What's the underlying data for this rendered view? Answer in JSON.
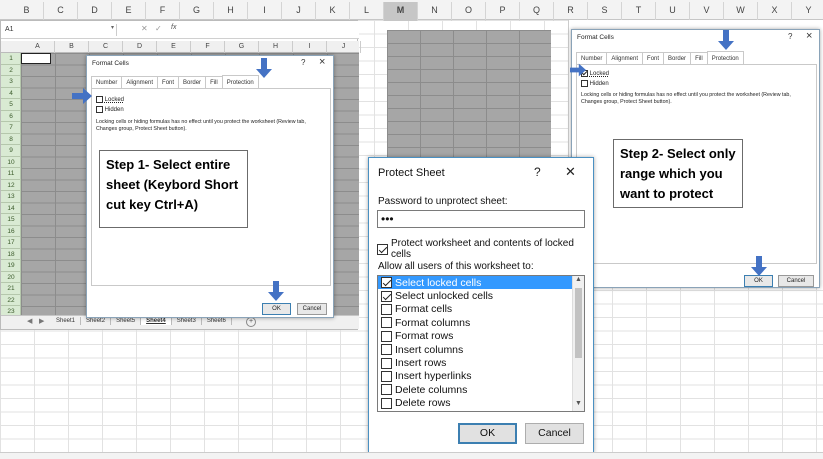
{
  "main_sheet": {
    "columns": [
      "B",
      "C",
      "D",
      "E",
      "F",
      "G",
      "H",
      "I",
      "J",
      "K",
      "L",
      "M",
      "N",
      "O",
      "P",
      "Q",
      "R",
      "S",
      "T",
      "U",
      "V",
      "W",
      "X",
      "Y"
    ],
    "selected_column": "M",
    "name_box": "A1",
    "fx_label": "fx"
  },
  "left_excel": {
    "columns": [
      "A",
      "B",
      "C",
      "D",
      "E",
      "F",
      "G",
      "H",
      "I",
      "J"
    ],
    "rows": [
      "1",
      "2",
      "3",
      "4",
      "5",
      "6",
      "7",
      "8",
      "9",
      "10",
      "11",
      "12",
      "13",
      "14",
      "15",
      "16",
      "17",
      "18",
      "19",
      "20",
      "21",
      "22",
      "23"
    ],
    "sheet_tabs": [
      "Sheet1",
      "Sheet2",
      "Sheet5",
      "Sheet4",
      "Sheet3",
      "Sheet6"
    ],
    "add_sheet_icon": "plus-circle"
  },
  "format_cells_left": {
    "title": "Format Cells",
    "help": "?",
    "close": "×",
    "tabs": [
      "Number",
      "Alignment",
      "Font",
      "Border",
      "Fill",
      "Protection"
    ],
    "active_tab": "Protection",
    "locked_label": "Locked",
    "hidden_label": "Hidden",
    "locked_checked": false,
    "info": "Locking cells or hiding formulas has no effect until you protect the worksheet (Review tab, Changes group, Protect Sheet button).",
    "ok": "OK",
    "cancel": "Cancel"
  },
  "format_cells_right": {
    "title": "Format Cells",
    "help": "?",
    "close": "×",
    "tabs": [
      "Number",
      "Alignment",
      "Font",
      "Border",
      "Fill",
      "Protection"
    ],
    "active_tab": "Protection",
    "locked_label": "Locked",
    "hidden_label": "Hidden",
    "locked_checked": true,
    "info": "Locking cells or hiding formulas has no effect until you protect the worksheet (Review tab, Changes group, Protect Sheet button).",
    "ok": "OK",
    "cancel": "Cancel"
  },
  "protect_sheet": {
    "title": "Protect Sheet",
    "help": "?",
    "close": "✕",
    "password_label": "Password to unprotect sheet:",
    "password_value": "•••",
    "protect_label": "Protect worksheet and contents of locked cells",
    "protect_checked": true,
    "allow_label": "Allow all users of this worksheet to:",
    "items": [
      {
        "label": "Select locked cells",
        "checked": true,
        "highlight": true
      },
      {
        "label": "Select unlocked cells",
        "checked": true,
        "highlight": false
      },
      {
        "label": "Format cells",
        "checked": false,
        "highlight": false
      },
      {
        "label": "Format columns",
        "checked": false,
        "highlight": false
      },
      {
        "label": "Format rows",
        "checked": false,
        "highlight": false
      },
      {
        "label": "Insert columns",
        "checked": false,
        "highlight": false
      },
      {
        "label": "Insert rows",
        "checked": false,
        "highlight": false
      },
      {
        "label": "Insert hyperlinks",
        "checked": false,
        "highlight": false
      },
      {
        "label": "Delete columns",
        "checked": false,
        "highlight": false
      },
      {
        "label": "Delete rows",
        "checked": false,
        "highlight": false
      }
    ],
    "ok": "OK",
    "cancel": "Cancel"
  },
  "callouts": {
    "step1": "Step 1- Select entire sheet (Keybord Short cut key Ctrl+A)",
    "step2": "Step 2- Select only range which you want to protect"
  },
  "colors": {
    "arrow": "#4472c4",
    "selection_gray": "#a6a6a6",
    "highlight": "#3399ff",
    "row_header_green": "#d9ead3"
  }
}
